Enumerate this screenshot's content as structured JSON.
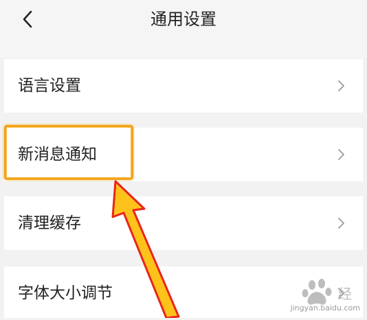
{
  "header": {
    "title": "通用设置",
    "back_icon": "chevron-left-icon"
  },
  "settings": {
    "items": [
      {
        "label": "语言设置",
        "icon": "chevron-right-icon"
      },
      {
        "label": "新消息通知",
        "icon": "chevron-right-icon",
        "highlighted": true
      },
      {
        "label": "清理缓存",
        "icon": "chevron-right-icon"
      },
      {
        "label": "字体大小调节",
        "icon": "chevron-right-icon"
      }
    ]
  },
  "annotation": {
    "highlight_color": "#f4a21a",
    "arrow_fill": "#ffc21a",
    "arrow_stroke": "#e8251c"
  },
  "watermark": {
    "text": "jingyan.baidu.com"
  },
  "colors": {
    "background": "#f2f2f2",
    "row_background": "#ffffff",
    "text": "#222222",
    "chevron": "#9a9a9a"
  }
}
